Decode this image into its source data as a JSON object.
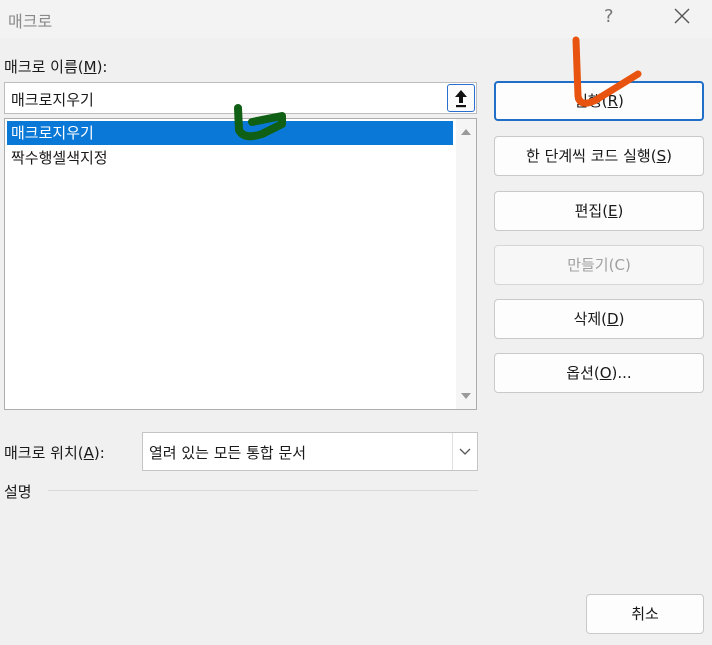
{
  "window": {
    "title": "매크로",
    "help_glyph": "?"
  },
  "macro_name": {
    "label": "매크로 이름(",
    "mnemonic": "M",
    "label_end": "):",
    "value": "매크로지우기"
  },
  "macro_list": {
    "items": [
      "매크로지우기",
      "짝수행셀색지정"
    ],
    "selected_index": 0
  },
  "buttons": [
    {
      "label": "실행(",
      "mnemonic": "R",
      "end": ")",
      "state": "primary"
    },
    {
      "label": "한 단계씩 코드 실행(",
      "mnemonic": "S",
      "end": ")",
      "state": "normal"
    },
    {
      "label": "편집(",
      "mnemonic": "E",
      "end": ")",
      "state": "normal"
    },
    {
      "label": "만들기(",
      "mnemonic": "C",
      "end": ")",
      "state": "disabled"
    },
    {
      "label": "삭제(",
      "mnemonic": "D",
      "end": ")",
      "state": "normal"
    },
    {
      "label": "옵션(",
      "mnemonic": "O",
      "end": ")...",
      "state": "normal"
    }
  ],
  "location": {
    "label": "매크로 위치(",
    "mnemonic": "A",
    "label_end": "):",
    "value": "열려 있는 모든 통합 문서"
  },
  "description": {
    "label": "설명"
  },
  "cancel": {
    "label": "취소"
  },
  "colors": {
    "selection": "#0a78d7",
    "primary_border": "#1f6ec7",
    "annotation_orange": "#e8540f",
    "annotation_green": "#0f5f14"
  }
}
